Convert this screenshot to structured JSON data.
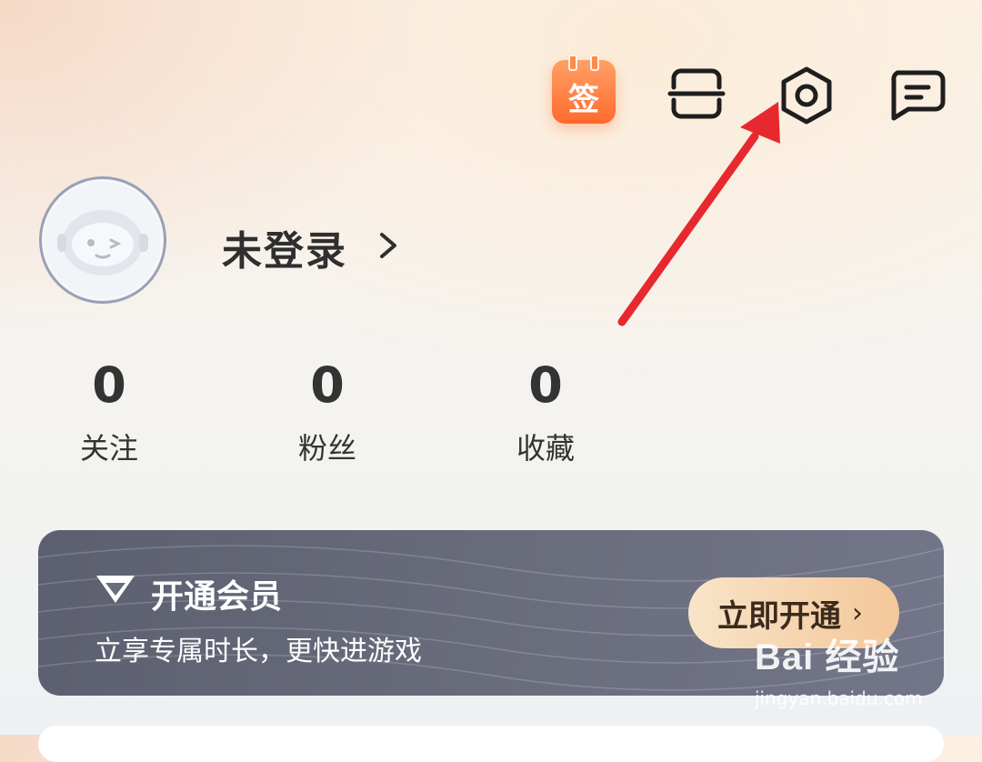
{
  "header": {
    "checkin_label": "签",
    "icons": [
      "calendar-checkin-icon",
      "scan-icon",
      "settings-icon",
      "message-icon"
    ]
  },
  "profile": {
    "username": "未登录",
    "avatar_icon": "robot-avatar-icon"
  },
  "stats": [
    {
      "value": "0",
      "label": "关注"
    },
    {
      "value": "0",
      "label": "粉丝"
    },
    {
      "value": "0",
      "label": "收藏"
    }
  ],
  "vip": {
    "title": "开通会员",
    "subtitle": "立享专属时长，更快进游戏",
    "button_label": "立即开通",
    "button_chevron": "›"
  },
  "watermark": {
    "brand": "Bai 经验",
    "url": "jingyan.baidu.com"
  },
  "colors": {
    "accent_orange": "#ff6a2e",
    "annotation_red": "#e8282f",
    "vip_card": "#62656f",
    "vip_button": "#f3c79a"
  }
}
